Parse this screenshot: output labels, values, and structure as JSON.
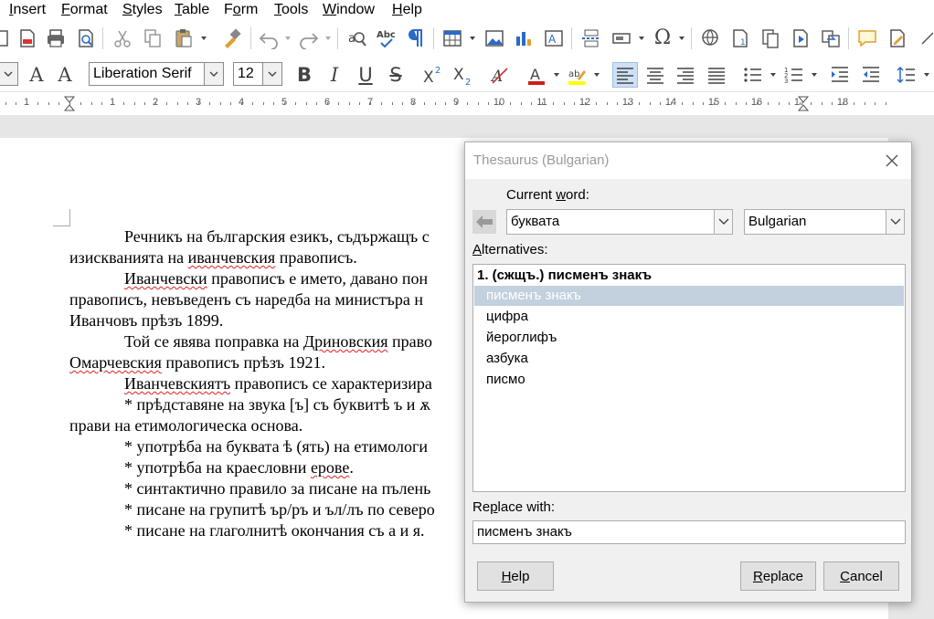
{
  "menubar": {
    "items": [
      {
        "first": "I",
        "rest": "nsert"
      },
      {
        "first": "F",
        "rest": "ormat"
      },
      {
        "first": "S",
        "rest": "tyles"
      },
      {
        "first": "T",
        "rest": "able"
      },
      {
        "pre": "F",
        "first": "o",
        "rest": "rm"
      },
      {
        "first": "T",
        "rest": "ools"
      },
      {
        "first": "W",
        "rest": "indow"
      },
      {
        "first": "H",
        "rest": "elp"
      }
    ]
  },
  "formatting": {
    "font_name": "Liberation Serif",
    "font_size": "12"
  },
  "ruler": {
    "numbers": [
      "1",
      "1",
      "2",
      "3",
      "4",
      "5",
      "6",
      "7",
      "8",
      "9",
      "10",
      "11",
      "12",
      "13",
      "14",
      "15",
      "16",
      "17",
      "18"
    ]
  },
  "document": {
    "l1a": "Речникъ на българския езикъ, съдържащъ с",
    "l2a": "изискванията на ",
    "l2b": "иванчевския",
    "l2c": " правописъ.",
    "l3a": "Иванчевски",
    "l3b": " правописъ е името, давано пон",
    "l4a": "правописъ, невъведенъ съ наредба на министъра н",
    "l5a": "Иванчовъ прѣзъ 1899.",
    "l6a": "Той се явява поправка на ",
    "l6b": "Дриновския",
    "l6c": " право",
    "l7a": "Омарчевския",
    "l7b": " правописъ прѣзъ 1921.",
    "l8a": "Иванчевскиятъ",
    "l8b": " правописъ се характеризира",
    "l9a": "* прѣдставяне на звука [ъ] съ буквитѣ ъ и ѫ",
    "l10a": "прави на етимологическа основа.",
    "l11a": "* употрѣба на буквата ѣ (ять) на етимологи",
    "l12a": "* употрѣба на краесловни ",
    "l12b": "ерове",
    "l12c": ".",
    "l13a": "* синтактично правило за писане на пълень",
    "l14a": "* писане на групитѣ ър/ръ и ъл/лъ по северо",
    "l15a": "* писане на глаголнитѣ окончания съ а и я."
  },
  "thesaurus": {
    "title": "Thesaurus (Bulgarian)",
    "current_word_label_pre": "Current ",
    "current_word_label_ul": "w",
    "current_word_label_post": "ord:",
    "current_word": "буквата",
    "language": "Bulgarian",
    "alternatives_label_ul": "A",
    "alternatives_label_post": "lternatives:",
    "meaning_heading": "1. (сжщъ.) писменъ знакъ",
    "alternatives": [
      "писменъ знакъ",
      "цифра",
      "йероглифъ",
      "азбука",
      "писмо"
    ],
    "selected_index": 0,
    "replace_label_pre": "Re",
    "replace_label_ul": "p",
    "replace_label_post": "lace with:",
    "replace_value": "писменъ знакъ",
    "help_ul": "H",
    "help_rest": "elp",
    "replace_btn_ul": "R",
    "replace_btn_rest": "eplace",
    "cancel_ul": "C",
    "cancel_rest": "ancel"
  },
  "colors": {
    "accent_selection": "#c3d0de",
    "toolbar_toggle": "#cde0f5",
    "spell_underline": "#d22"
  }
}
